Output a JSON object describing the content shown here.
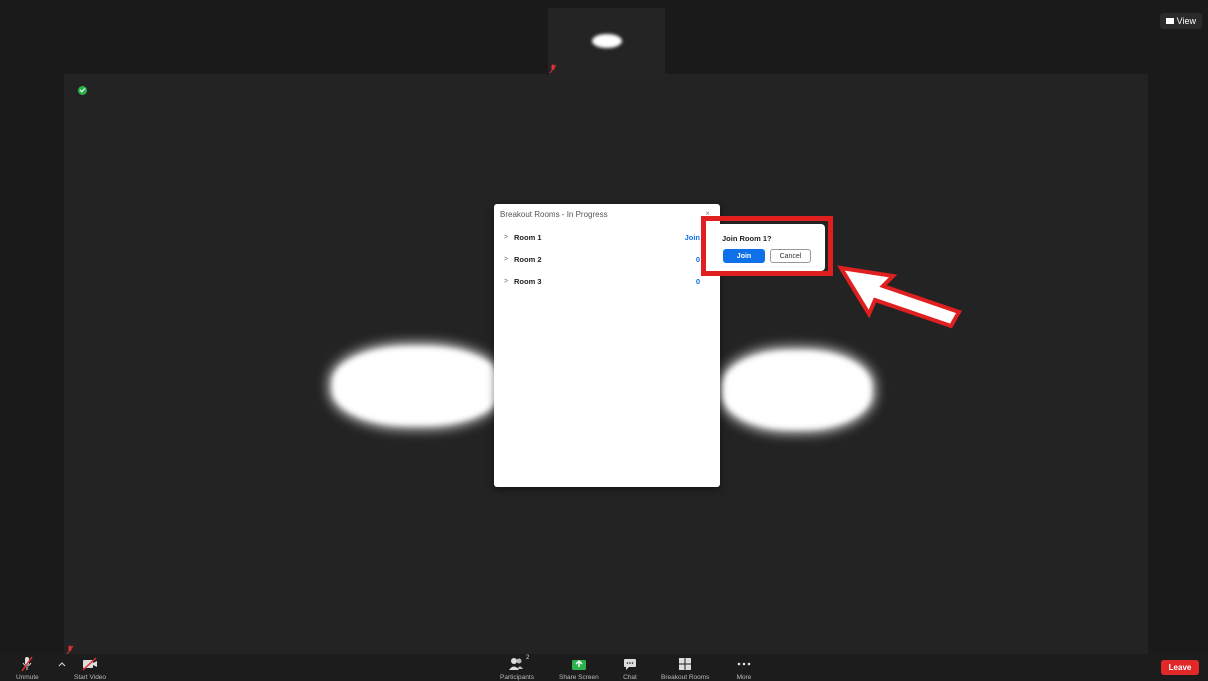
{
  "header": {
    "view_label": "View"
  },
  "breakout_panel": {
    "title": "Breakout Rooms - In Progress",
    "close": "×",
    "rooms": [
      {
        "name": "Room 1",
        "action": "Join"
      },
      {
        "name": "Room 2",
        "action": "0"
      },
      {
        "name": "Room 3",
        "action": "0"
      }
    ]
  },
  "join_popover": {
    "question": "Join Room 1?",
    "join_label": "Join",
    "cancel_label": "Cancel"
  },
  "toolbar": {
    "unmute": "Unmute",
    "start_video": "Start Video",
    "participants": "Participants",
    "participants_count": "2",
    "share_screen": "Share Screen",
    "chat": "Chat",
    "breakout_rooms": "Breakout Rooms",
    "more": "More",
    "leave": "Leave"
  },
  "colors": {
    "accent_blue": "#0e71eb",
    "highlight_red": "#e02020",
    "leave_red": "#e02828",
    "share_green": "#2bb24c"
  }
}
